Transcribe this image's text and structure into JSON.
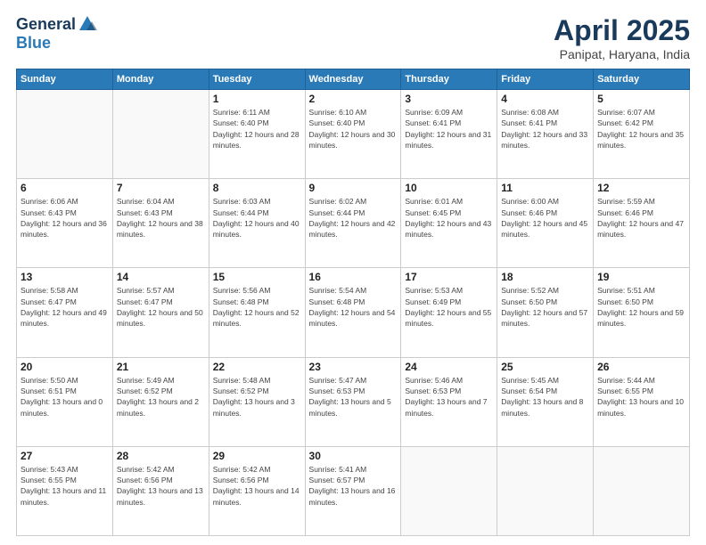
{
  "logo": {
    "general": "General",
    "blue": "Blue"
  },
  "title": {
    "month": "April 2025",
    "location": "Panipat, Haryana, India"
  },
  "weekdays": [
    "Sunday",
    "Monday",
    "Tuesday",
    "Wednesday",
    "Thursday",
    "Friday",
    "Saturday"
  ],
  "weeks": [
    [
      {
        "num": "",
        "sunrise": "",
        "sunset": "",
        "daylight": ""
      },
      {
        "num": "",
        "sunrise": "",
        "sunset": "",
        "daylight": ""
      },
      {
        "num": "1",
        "sunrise": "Sunrise: 6:11 AM",
        "sunset": "Sunset: 6:40 PM",
        "daylight": "Daylight: 12 hours and 28 minutes."
      },
      {
        "num": "2",
        "sunrise": "Sunrise: 6:10 AM",
        "sunset": "Sunset: 6:40 PM",
        "daylight": "Daylight: 12 hours and 30 minutes."
      },
      {
        "num": "3",
        "sunrise": "Sunrise: 6:09 AM",
        "sunset": "Sunset: 6:41 PM",
        "daylight": "Daylight: 12 hours and 31 minutes."
      },
      {
        "num": "4",
        "sunrise": "Sunrise: 6:08 AM",
        "sunset": "Sunset: 6:41 PM",
        "daylight": "Daylight: 12 hours and 33 minutes."
      },
      {
        "num": "5",
        "sunrise": "Sunrise: 6:07 AM",
        "sunset": "Sunset: 6:42 PM",
        "daylight": "Daylight: 12 hours and 35 minutes."
      }
    ],
    [
      {
        "num": "6",
        "sunrise": "Sunrise: 6:06 AM",
        "sunset": "Sunset: 6:43 PM",
        "daylight": "Daylight: 12 hours and 36 minutes."
      },
      {
        "num": "7",
        "sunrise": "Sunrise: 6:04 AM",
        "sunset": "Sunset: 6:43 PM",
        "daylight": "Daylight: 12 hours and 38 minutes."
      },
      {
        "num": "8",
        "sunrise": "Sunrise: 6:03 AM",
        "sunset": "Sunset: 6:44 PM",
        "daylight": "Daylight: 12 hours and 40 minutes."
      },
      {
        "num": "9",
        "sunrise": "Sunrise: 6:02 AM",
        "sunset": "Sunset: 6:44 PM",
        "daylight": "Daylight: 12 hours and 42 minutes."
      },
      {
        "num": "10",
        "sunrise": "Sunrise: 6:01 AM",
        "sunset": "Sunset: 6:45 PM",
        "daylight": "Daylight: 12 hours and 43 minutes."
      },
      {
        "num": "11",
        "sunrise": "Sunrise: 6:00 AM",
        "sunset": "Sunset: 6:46 PM",
        "daylight": "Daylight: 12 hours and 45 minutes."
      },
      {
        "num": "12",
        "sunrise": "Sunrise: 5:59 AM",
        "sunset": "Sunset: 6:46 PM",
        "daylight": "Daylight: 12 hours and 47 minutes."
      }
    ],
    [
      {
        "num": "13",
        "sunrise": "Sunrise: 5:58 AM",
        "sunset": "Sunset: 6:47 PM",
        "daylight": "Daylight: 12 hours and 49 minutes."
      },
      {
        "num": "14",
        "sunrise": "Sunrise: 5:57 AM",
        "sunset": "Sunset: 6:47 PM",
        "daylight": "Daylight: 12 hours and 50 minutes."
      },
      {
        "num": "15",
        "sunrise": "Sunrise: 5:56 AM",
        "sunset": "Sunset: 6:48 PM",
        "daylight": "Daylight: 12 hours and 52 minutes."
      },
      {
        "num": "16",
        "sunrise": "Sunrise: 5:54 AM",
        "sunset": "Sunset: 6:48 PM",
        "daylight": "Daylight: 12 hours and 54 minutes."
      },
      {
        "num": "17",
        "sunrise": "Sunrise: 5:53 AM",
        "sunset": "Sunset: 6:49 PM",
        "daylight": "Daylight: 12 hours and 55 minutes."
      },
      {
        "num": "18",
        "sunrise": "Sunrise: 5:52 AM",
        "sunset": "Sunset: 6:50 PM",
        "daylight": "Daylight: 12 hours and 57 minutes."
      },
      {
        "num": "19",
        "sunrise": "Sunrise: 5:51 AM",
        "sunset": "Sunset: 6:50 PM",
        "daylight": "Daylight: 12 hours and 59 minutes."
      }
    ],
    [
      {
        "num": "20",
        "sunrise": "Sunrise: 5:50 AM",
        "sunset": "Sunset: 6:51 PM",
        "daylight": "Daylight: 13 hours and 0 minutes."
      },
      {
        "num": "21",
        "sunrise": "Sunrise: 5:49 AM",
        "sunset": "Sunset: 6:52 PM",
        "daylight": "Daylight: 13 hours and 2 minutes."
      },
      {
        "num": "22",
        "sunrise": "Sunrise: 5:48 AM",
        "sunset": "Sunset: 6:52 PM",
        "daylight": "Daylight: 13 hours and 3 minutes."
      },
      {
        "num": "23",
        "sunrise": "Sunrise: 5:47 AM",
        "sunset": "Sunset: 6:53 PM",
        "daylight": "Daylight: 13 hours and 5 minutes."
      },
      {
        "num": "24",
        "sunrise": "Sunrise: 5:46 AM",
        "sunset": "Sunset: 6:53 PM",
        "daylight": "Daylight: 13 hours and 7 minutes."
      },
      {
        "num": "25",
        "sunrise": "Sunrise: 5:45 AM",
        "sunset": "Sunset: 6:54 PM",
        "daylight": "Daylight: 13 hours and 8 minutes."
      },
      {
        "num": "26",
        "sunrise": "Sunrise: 5:44 AM",
        "sunset": "Sunset: 6:55 PM",
        "daylight": "Daylight: 13 hours and 10 minutes."
      }
    ],
    [
      {
        "num": "27",
        "sunrise": "Sunrise: 5:43 AM",
        "sunset": "Sunset: 6:55 PM",
        "daylight": "Daylight: 13 hours and 11 minutes."
      },
      {
        "num": "28",
        "sunrise": "Sunrise: 5:42 AM",
        "sunset": "Sunset: 6:56 PM",
        "daylight": "Daylight: 13 hours and 13 minutes."
      },
      {
        "num": "29",
        "sunrise": "Sunrise: 5:42 AM",
        "sunset": "Sunset: 6:56 PM",
        "daylight": "Daylight: 13 hours and 14 minutes."
      },
      {
        "num": "30",
        "sunrise": "Sunrise: 5:41 AM",
        "sunset": "Sunset: 6:57 PM",
        "daylight": "Daylight: 13 hours and 16 minutes."
      },
      {
        "num": "",
        "sunrise": "",
        "sunset": "",
        "daylight": ""
      },
      {
        "num": "",
        "sunrise": "",
        "sunset": "",
        "daylight": ""
      },
      {
        "num": "",
        "sunrise": "",
        "sunset": "",
        "daylight": ""
      }
    ]
  ]
}
